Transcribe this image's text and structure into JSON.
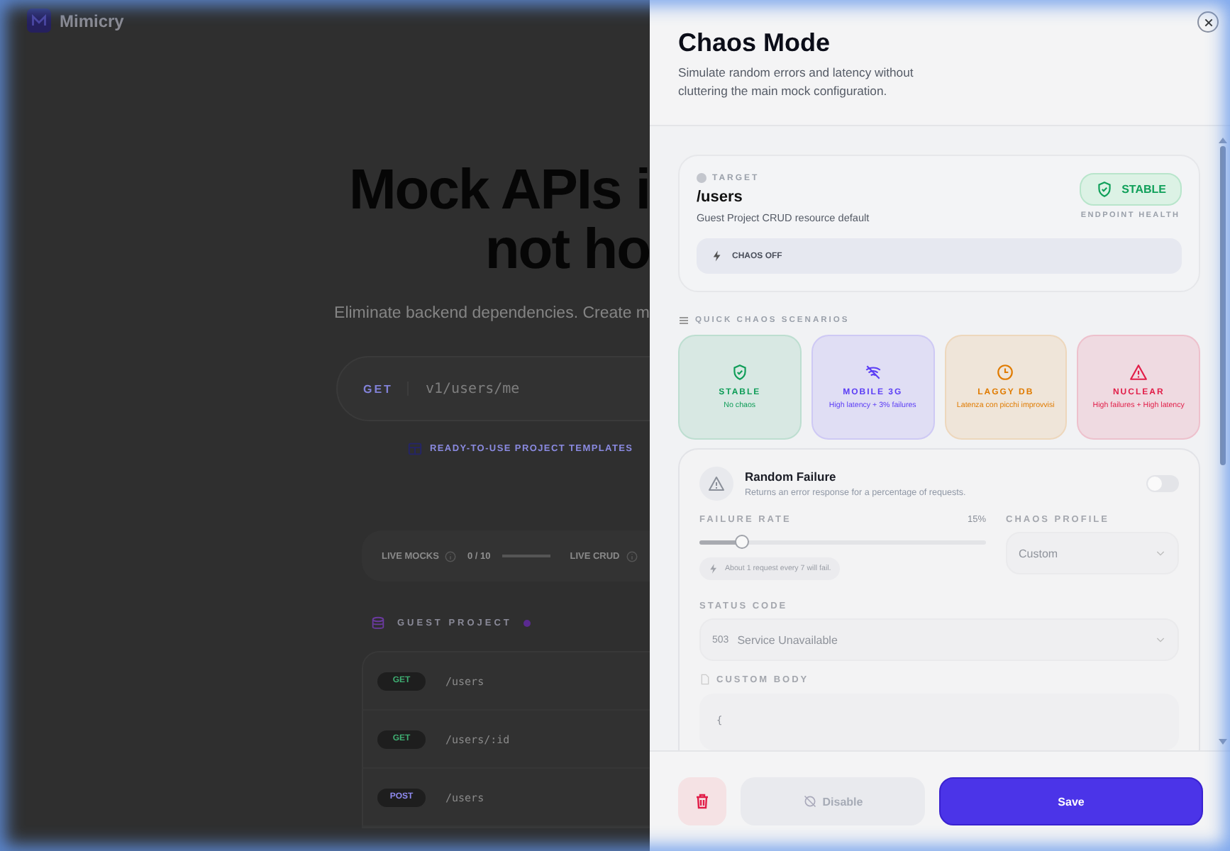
{
  "background_page": {
    "logo": "Mimicry",
    "headline": [
      "Mock APIs i",
      "not ho"
    ],
    "subtitle": "Eliminate backend dependencies. Create m",
    "request_bar": {
      "method": "GET",
      "placeholder": "v1/users/me"
    },
    "templates_link": "READY-TO-USE PROJECT TEMPLATES",
    "stats": [
      {
        "label": "LIVE MOCKS",
        "value": "0 / 10"
      },
      {
        "label": "LIVE CRUD"
      }
    ],
    "project": {
      "name": "GUEST PROJECT",
      "routes": [
        {
          "method": "GET",
          "path": "/users",
          "color": "#3fae72"
        },
        {
          "method": "GET",
          "path": "/users/:id",
          "color": "#3fae72"
        },
        {
          "method": "POST",
          "path": "/users",
          "color": "#8f8af0"
        }
      ]
    }
  },
  "drawer": {
    "title": "Chaos Mode",
    "description": "Simulate random errors and latency without cluttering the main mock configuration.",
    "target": {
      "label": "TARGET",
      "path": "/users",
      "detail": "Guest Project CRUD resource default",
      "health": "STABLE",
      "health_label": "ENDPOINT HEALTH",
      "chaos_status": "CHAOS OFF"
    },
    "scenarios_title": "QUICK CHAOS SCENARIOS",
    "scenarios": [
      {
        "kind": "shield",
        "name": "STABLE",
        "detail": "No chaos",
        "color": "#0f9d58"
      },
      {
        "kind": "no-wifi",
        "name": "MOBILE 3G",
        "detail": "High latency + 3% failures",
        "color": "#5b3df5"
      },
      {
        "kind": "clock",
        "name": "LAGGY DB",
        "detail": "Latenza con picchi improvvisi",
        "color": "#e07b00"
      },
      {
        "kind": "warning",
        "name": "NUCLEAR",
        "detail": "High failures + High latency",
        "color": "#e11d48"
      }
    ],
    "random_failure": {
      "title": "Random Failure",
      "description": "Returns an error response for a percentage of requests.",
      "on": false,
      "rate_label": "FAILURE RATE",
      "rate": "15%",
      "level": 0.15,
      "hint": "About 1 request every 7 will fail.",
      "profile_label": "CHAOS PROFILE",
      "profile": "Custom",
      "status_label": "STATUS CODE",
      "status_code": "503",
      "status_text": "Service Unavailable",
      "body_label": "CUSTOM BODY",
      "body_first_line": "{"
    },
    "footer": {
      "disable": "Disable",
      "save": "Save"
    }
  }
}
